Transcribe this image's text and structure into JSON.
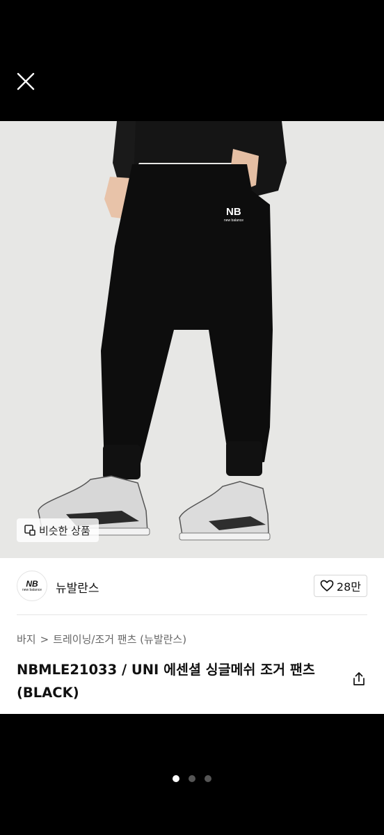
{
  "top_bar": {
    "close_icon": "close-icon"
  },
  "photo": {
    "description_icon": "product-photo",
    "similar_button": {
      "icon": "similar-search-icon",
      "label": "비슷한 상품"
    }
  },
  "brand": {
    "logo_text": "NB",
    "logo_subtext": "new balance",
    "name": "뉴발란스",
    "likes": "28만",
    "like_icon": "heart-icon"
  },
  "breadcrumb": {
    "category": "바지",
    "separator": ">",
    "subcategory": "트레이닝/조거 팬츠 (뉴발란스)"
  },
  "product": {
    "title": "NBMLE21033 / UNI 에센셜 싱글메쉬 조거 팬츠 (BLACK)",
    "share_icon": "share-icon"
  },
  "pagination": {
    "total": 3,
    "current": 1
  },
  "colors": {
    "background": "#000000",
    "panel": "#ffffff",
    "photo_bg": "#e7e7e5"
  }
}
